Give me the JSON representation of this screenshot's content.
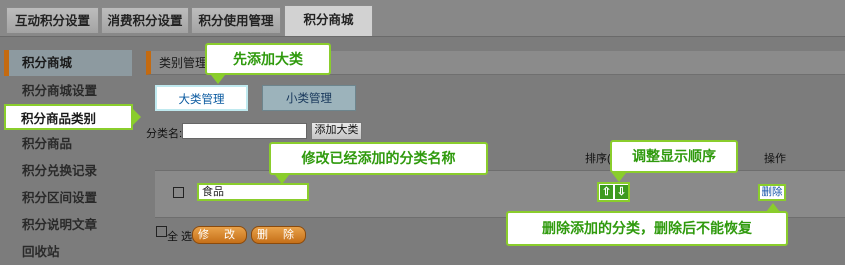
{
  "tabs": [
    "互动积分设置",
    "消费积分设置",
    "积分使用管理",
    "积分商城"
  ],
  "sidebar": {
    "header": "积分商城",
    "items": [
      "积分商城设置",
      "积分商品类别",
      "积分商品",
      "积分兑换记录",
      "积分区间设置",
      "积分说明文章",
      "回收站"
    ]
  },
  "main": {
    "title": "类别管理",
    "subtabs": [
      "大类管理",
      "小类管理"
    ],
    "form": {
      "label": "分类名:",
      "input_value": "",
      "add_button": "添加大类"
    },
    "columns": {
      "order_partial": "排序(",
      "action": "操作"
    },
    "row": {
      "name_value": "食品",
      "up_glyph": "⇧",
      "down_glyph": "⇩",
      "delete_link": "删除"
    },
    "footer": {
      "select_all": "全 选",
      "modify_button": "修 改",
      "delete_button": "删 除"
    }
  },
  "callouts": {
    "add_category": "先添加大类",
    "edit_name": "修改已经添加的分类名称",
    "adjust_order": "调整显示顺序",
    "delete_note": "删除添加的分类，删除后不能恢复"
  },
  "colors": {
    "accent_green": "#8acd2c",
    "callout_text": "#2f9a0d",
    "sidebar_marker": "#c46a10",
    "link_blue": "#1453a8"
  }
}
